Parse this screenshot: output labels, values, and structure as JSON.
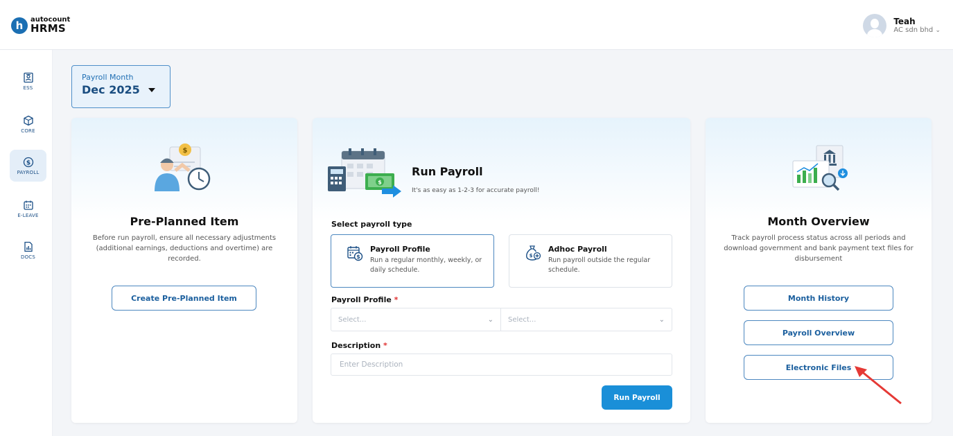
{
  "brand": {
    "logo_letter": "h",
    "logo_small": "autocount",
    "logo_big": "HRMS"
  },
  "user": {
    "name": "Teah",
    "company": "AC sdn bhd",
    "dropdown_icon": "chevron-down-icon"
  },
  "sidebar": {
    "items": [
      {
        "label": "ESS",
        "icon": "id-card-icon",
        "active": false
      },
      {
        "label": "CORE",
        "icon": "cube-icon",
        "active": false
      },
      {
        "label": "PAYROLL",
        "icon": "dollar-coin-icon",
        "active": true
      },
      {
        "label": "E-LEAVE",
        "icon": "calendar-icon",
        "active": false
      },
      {
        "label": "DOCS",
        "icon": "document-chart-icon",
        "active": false
      }
    ]
  },
  "payroll_month": {
    "label": "Payroll Month",
    "value": "Dec 2025"
  },
  "pre_planned": {
    "title": "Pre-Planned Item",
    "description": "Before run payroll, ensure all necessary adjustments (additional earnings, deductions and overtime) are recorded.",
    "button": "Create Pre-Planned Item"
  },
  "run_payroll": {
    "title": "Run Payroll",
    "subtitle": "It's as easy as 1-2-3 for accurate payroll!",
    "select_type_label": "Select payroll type",
    "types": [
      {
        "title": "Payroll Profile",
        "description": "Run a regular monthly, weekly, or daily schedule.",
        "selected": true
      },
      {
        "title": "Adhoc Payroll",
        "description": "Run payroll outside the regular schedule.",
        "selected": false
      }
    ],
    "profile_label": "Payroll Profile",
    "required_mark": "*",
    "select1_placeholder": "Select...",
    "select2_placeholder": "Select...",
    "description_label": "Description",
    "description_placeholder": "Enter Description",
    "button": "Run Payroll"
  },
  "month_overview": {
    "title": "Month Overview",
    "description": "Track payroll process status across all periods and download government and bank payment text files for disbursement",
    "buttons": [
      "Month History",
      "Payroll Overview",
      "Electronic Files"
    ]
  },
  "colors": {
    "primary": "#1a8fd8",
    "accent_dark": "#1a4d80",
    "annotation_arrow": "#e53935"
  }
}
